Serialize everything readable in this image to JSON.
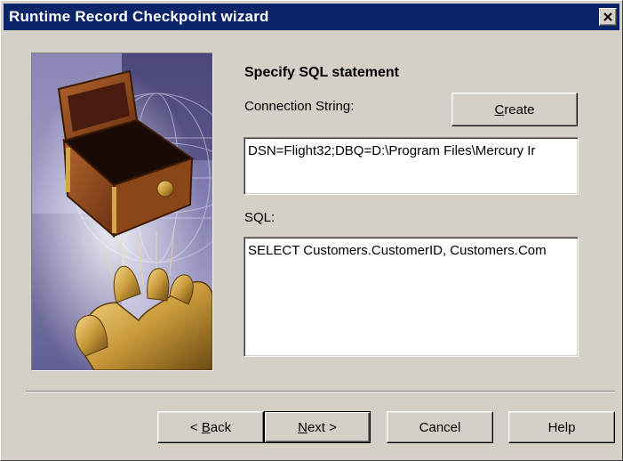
{
  "window": {
    "title": "Runtime Record Checkpoint wizard",
    "close_label": "×"
  },
  "illustration": {
    "icon": "wizard-illustration-treasure-box-and-golden-hand"
  },
  "main": {
    "heading": "Specify SQL statement",
    "connection_label": "Connection String:",
    "create_button": {
      "mnemonic": "C",
      "rest": "reate"
    },
    "connection_value": "DSN=Flight32;DBQ=D:\\Program Files\\Mercury Ir",
    "sql_label": "SQL:",
    "sql_value": "SELECT Customers.CustomerID, Customers.Com"
  },
  "footer": {
    "back_button": {
      "prefix": "< ",
      "mnemonic": "B",
      "rest": "ack"
    },
    "next_button": {
      "mnemonic": "N",
      "rest": "ext >"
    },
    "cancel_label": "Cancel",
    "help_label": "Help"
  },
  "colors": {
    "titlebar": "#0a246a",
    "face": "#d4d0c8"
  }
}
